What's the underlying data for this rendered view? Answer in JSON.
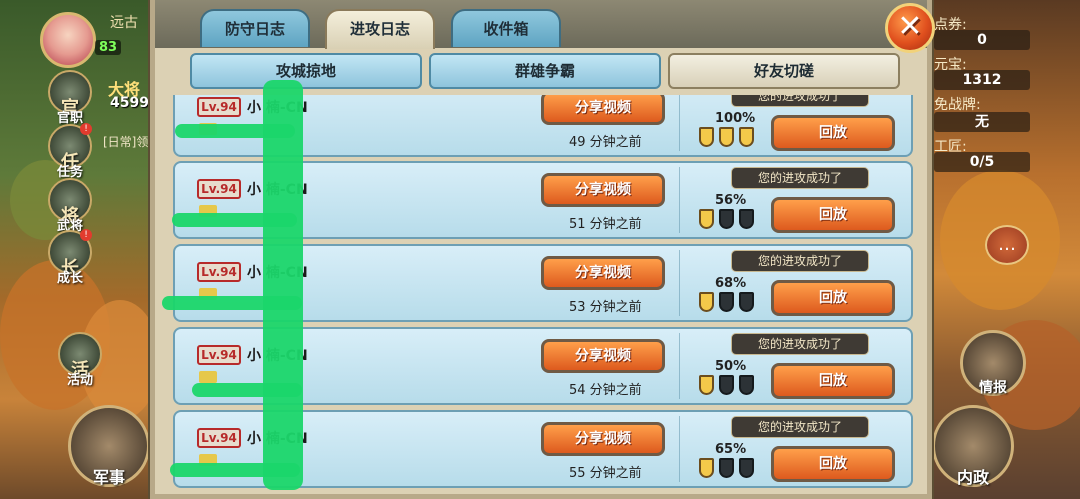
{
  "hud": {
    "top_left_label": "远古",
    "level": "83",
    "rank": "大将",
    "power": "4599",
    "quest_tip": "[日常]领",
    "side_buttons": [
      {
        "name": "official",
        "label": "官职",
        "glyph": "官"
      },
      {
        "name": "tasks",
        "label": "任务",
        "glyph": "任"
      },
      {
        "name": "generals",
        "label": "武将",
        "glyph": "将"
      },
      {
        "name": "growth",
        "label": "成长",
        "glyph": "长"
      },
      {
        "name": "events",
        "label": "活动",
        "glyph": "活"
      }
    ],
    "military_label": "军事",
    "right": {
      "points_label": "点券:",
      "points_value": "0",
      "ingots_label": "元宝:",
      "ingots_value": "1312",
      "truce_label": "免战牌:",
      "truce_value": "无",
      "craftsmen_label": "工匠:",
      "craftsmen_value": "0/5",
      "intel_label": "情报",
      "domestic_label": "内政"
    }
  },
  "dialog": {
    "close_icon": "✕",
    "tabs": [
      {
        "label": "防守日志",
        "active": false
      },
      {
        "label": "进攻日志",
        "active": true
      },
      {
        "label": "收件箱",
        "active": false
      }
    ],
    "filters": [
      {
        "label": "攻城掠地",
        "active": false
      },
      {
        "label": "群雄争霸",
        "active": false
      },
      {
        "label": "好友切磋",
        "active": true
      }
    ],
    "share_label": "分享视频",
    "replay_label": "回放",
    "result_text": "您的进攻成功了",
    "entries": [
      {
        "level": "Lv.94",
        "name": "小 楠-CN",
        "time_ago": "49 分钟之前",
        "percent": "100%",
        "stars": 3,
        "show_banner": true
      },
      {
        "level": "Lv.94",
        "name": "小 楠-CN",
        "time_ago": "51 分钟之前",
        "percent": "56%",
        "stars": 1,
        "show_banner": true
      },
      {
        "level": "Lv.94",
        "name": "小 楠-CN",
        "time_ago": "53 分钟之前",
        "percent": "68%",
        "stars": 1,
        "show_banner": true
      },
      {
        "level": "Lv.94",
        "name": "小 楠-CN",
        "time_ago": "54 分钟之前",
        "percent": "50%",
        "stars": 1,
        "show_banner": true
      },
      {
        "level": "Lv.94",
        "name": "小 楠-CN",
        "time_ago": "55 分钟之前",
        "percent": "65%",
        "stars": 1,
        "show_banner": true
      }
    ]
  }
}
